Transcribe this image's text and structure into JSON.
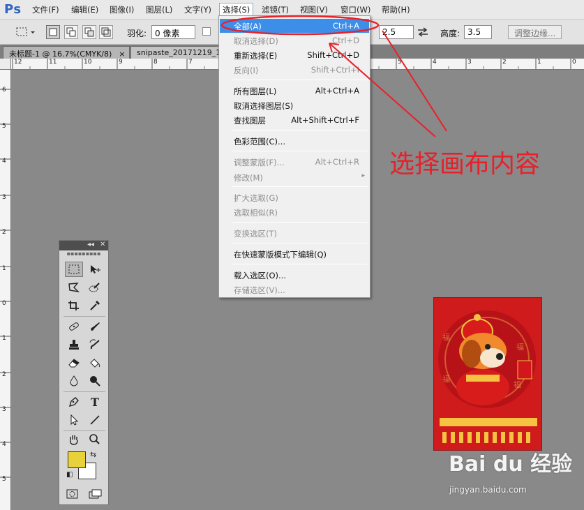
{
  "app": {
    "logo": "Ps"
  },
  "menubar": {
    "items": [
      {
        "label": "文件(F)"
      },
      {
        "label": "编辑(E)"
      },
      {
        "label": "图像(I)"
      },
      {
        "label": "图层(L)"
      },
      {
        "label": "文字(Y)"
      },
      {
        "label": "选择(S)"
      },
      {
        "label": "滤镜(T)"
      },
      {
        "label": "视图(V)"
      },
      {
        "label": "窗口(W)"
      },
      {
        "label": "帮助(H)"
      }
    ],
    "active_item": "选择(S)"
  },
  "options": {
    "feather_label": "羽化:",
    "feather_value": "0 像素",
    "width_value": "2.5",
    "height_label": "高度:",
    "height_value": "3.5",
    "refine_edge_button": "调整边缘..."
  },
  "tabs": [
    {
      "label": "未标题-1 @ 16.7%(CMYK/8)",
      "close": "×"
    },
    {
      "label": "snipaste_20171219_1"
    }
  ],
  "rulers": {
    "top": [
      "12",
      "11",
      "10",
      "9",
      "8",
      "7",
      "6",
      "5",
      "4",
      "3",
      "2",
      "1",
      "0",
      "1"
    ],
    "left": [
      "6",
      "5",
      "4",
      "3",
      "2",
      "1",
      "0",
      "1",
      "2",
      "3",
      "4",
      "5"
    ]
  },
  "select_menu": {
    "groups": [
      [
        {
          "label": "全部(A)",
          "shortcut": "Ctrl+A",
          "state": "highlighted"
        },
        {
          "label": "取消选择(D)",
          "shortcut": "Ctrl+D",
          "state": "disabled"
        },
        {
          "label": "重新选择(E)",
          "shortcut": "Shift+Ctrl+D",
          "state": "enabled"
        },
        {
          "label": "反向(I)",
          "shortcut": "Shift+Ctrl+I",
          "state": "disabled"
        }
      ],
      [
        {
          "label": "所有图层(L)",
          "shortcut": "Alt+Ctrl+A",
          "state": "enabled"
        },
        {
          "label": "取消选择图层(S)",
          "shortcut": "",
          "state": "enabled"
        },
        {
          "label": "查找图层",
          "shortcut": "Alt+Shift+Ctrl+F",
          "state": "enabled"
        }
      ],
      [
        {
          "label": "色彩范围(C)...",
          "shortcut": "",
          "state": "enabled"
        }
      ],
      [
        {
          "label": "调整蒙版(F)...",
          "shortcut": "Alt+Ctrl+R",
          "state": "disabled"
        },
        {
          "label": "修改(M)",
          "shortcut": "",
          "state": "disabled",
          "submenu": "▸"
        }
      ],
      [
        {
          "label": "扩大选取(G)",
          "shortcut": "",
          "state": "disabled"
        },
        {
          "label": "选取相似(R)",
          "shortcut": "",
          "state": "disabled"
        }
      ],
      [
        {
          "label": "变换选区(T)",
          "shortcut": "",
          "state": "disabled"
        }
      ],
      [
        {
          "label": "在快速蒙版模式下编辑(Q)",
          "shortcut": "",
          "state": "enabled"
        }
      ],
      [
        {
          "label": "载入选区(O)...",
          "shortcut": "",
          "state": "enabled"
        },
        {
          "label": "存储选区(V)...",
          "shortcut": "",
          "state": "disabled"
        }
      ]
    ]
  },
  "annotation": {
    "text": "选择画布内容",
    "color": "#e8202a"
  },
  "toolbox": {
    "header_collapse": "◂◂",
    "header_close": "✕",
    "foreground_color": "#e8d23a",
    "background_color": "#ffffff"
  },
  "watermark": {
    "logo": "Bai du 经验",
    "url": "jingyan.baidu.com"
  },
  "colors": {
    "menu_highlight": "#3d8ee8",
    "canvas": "#898989",
    "image_bg": "#cf1b1b"
  }
}
